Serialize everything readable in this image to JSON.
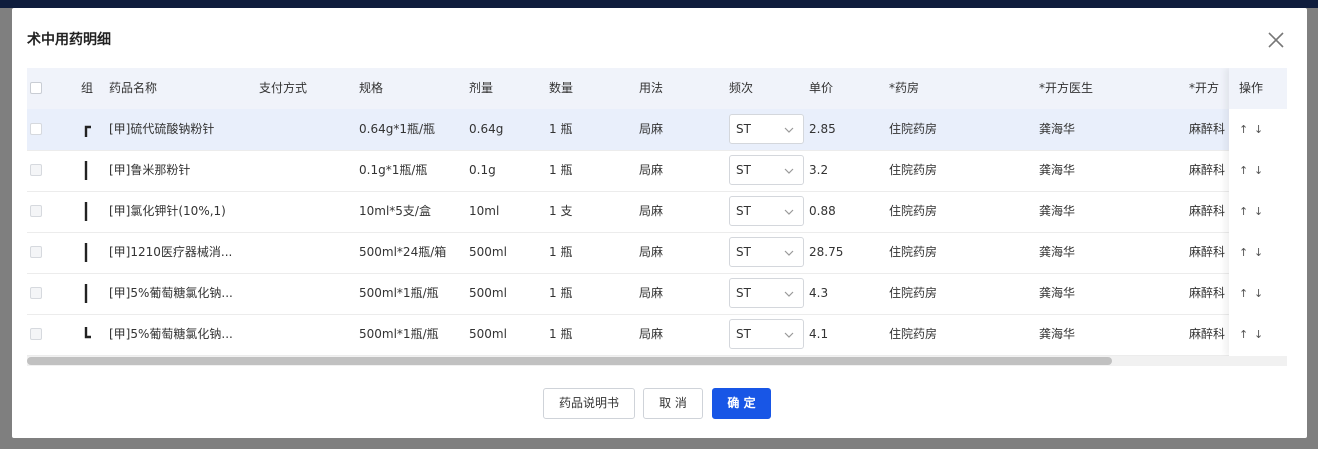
{
  "dialog": {
    "title": "术中用药明细"
  },
  "table": {
    "headers": {
      "group": "组",
      "name": "药品名称",
      "payment": "支付方式",
      "spec": "规格",
      "dose": "剂量",
      "qty": "数量",
      "usage": "用法",
      "freq": "频次",
      "price": "单价",
      "pharmacy": "*药房",
      "doctor": "*开方医生",
      "dept": "*开方",
      "ops": "操作"
    },
    "rows": [
      {
        "name": "[甲]硫代硫酸钠粉针",
        "payment": "",
        "spec": "0.64g*1瓶/瓶",
        "dose": "0.64g",
        "qty": "1 瓶",
        "usage": "局麻",
        "freq": "ST",
        "price": "2.85",
        "pharmacy": "住院药房",
        "doctor": "龚海华",
        "dept": "麻醉科"
      },
      {
        "name": "[甲]鲁米那粉针",
        "payment": "",
        "spec": "0.1g*1瓶/瓶",
        "dose": "0.1g",
        "qty": "1 瓶",
        "usage": "局麻",
        "freq": "ST",
        "price": "3.2",
        "pharmacy": "住院药房",
        "doctor": "龚海华",
        "dept": "麻醉科"
      },
      {
        "name": "[甲]氯化钾针(10%,1)",
        "payment": "",
        "spec": "10ml*5支/盒",
        "dose": "10ml",
        "qty": "1 支",
        "usage": "局麻",
        "freq": "ST",
        "price": "0.88",
        "pharmacy": "住院药房",
        "doctor": "龚海华",
        "dept": "麻醉科"
      },
      {
        "name": "[甲]1210医疗器械消...",
        "payment": "",
        "spec": "500ml*24瓶/箱",
        "dose": "500ml",
        "qty": "1 瓶",
        "usage": "局麻",
        "freq": "ST",
        "price": "28.75",
        "pharmacy": "住院药房",
        "doctor": "龚海华",
        "dept": "麻醉科"
      },
      {
        "name": "[甲]5%葡萄糖氯化钠...",
        "payment": "",
        "spec": "500ml*1瓶/瓶",
        "dose": "500ml",
        "qty": "1 瓶",
        "usage": "局麻",
        "freq": "ST",
        "price": "4.3",
        "pharmacy": "住院药房",
        "doctor": "龚海华",
        "dept": "麻醉科"
      },
      {
        "name": "[甲]5%葡萄糖氯化钠...",
        "payment": "",
        "spec": "500ml*1瓶/瓶",
        "dose": "500ml",
        "qty": "1 瓶",
        "usage": "局麻",
        "freq": "ST",
        "price": "4.1",
        "pharmacy": "住院药房",
        "doctor": "龚海华",
        "dept": "麻醉科"
      }
    ]
  },
  "footer": {
    "manual_label": "药品说明书",
    "cancel_label": "取 消",
    "confirm_label": "确 定"
  },
  "ops": {
    "up": "↑",
    "down": "↓"
  },
  "colors": {
    "primary": "#1856e6",
    "header_bg": "#f0f3fa",
    "selected_row_bg": "#e9effb"
  }
}
